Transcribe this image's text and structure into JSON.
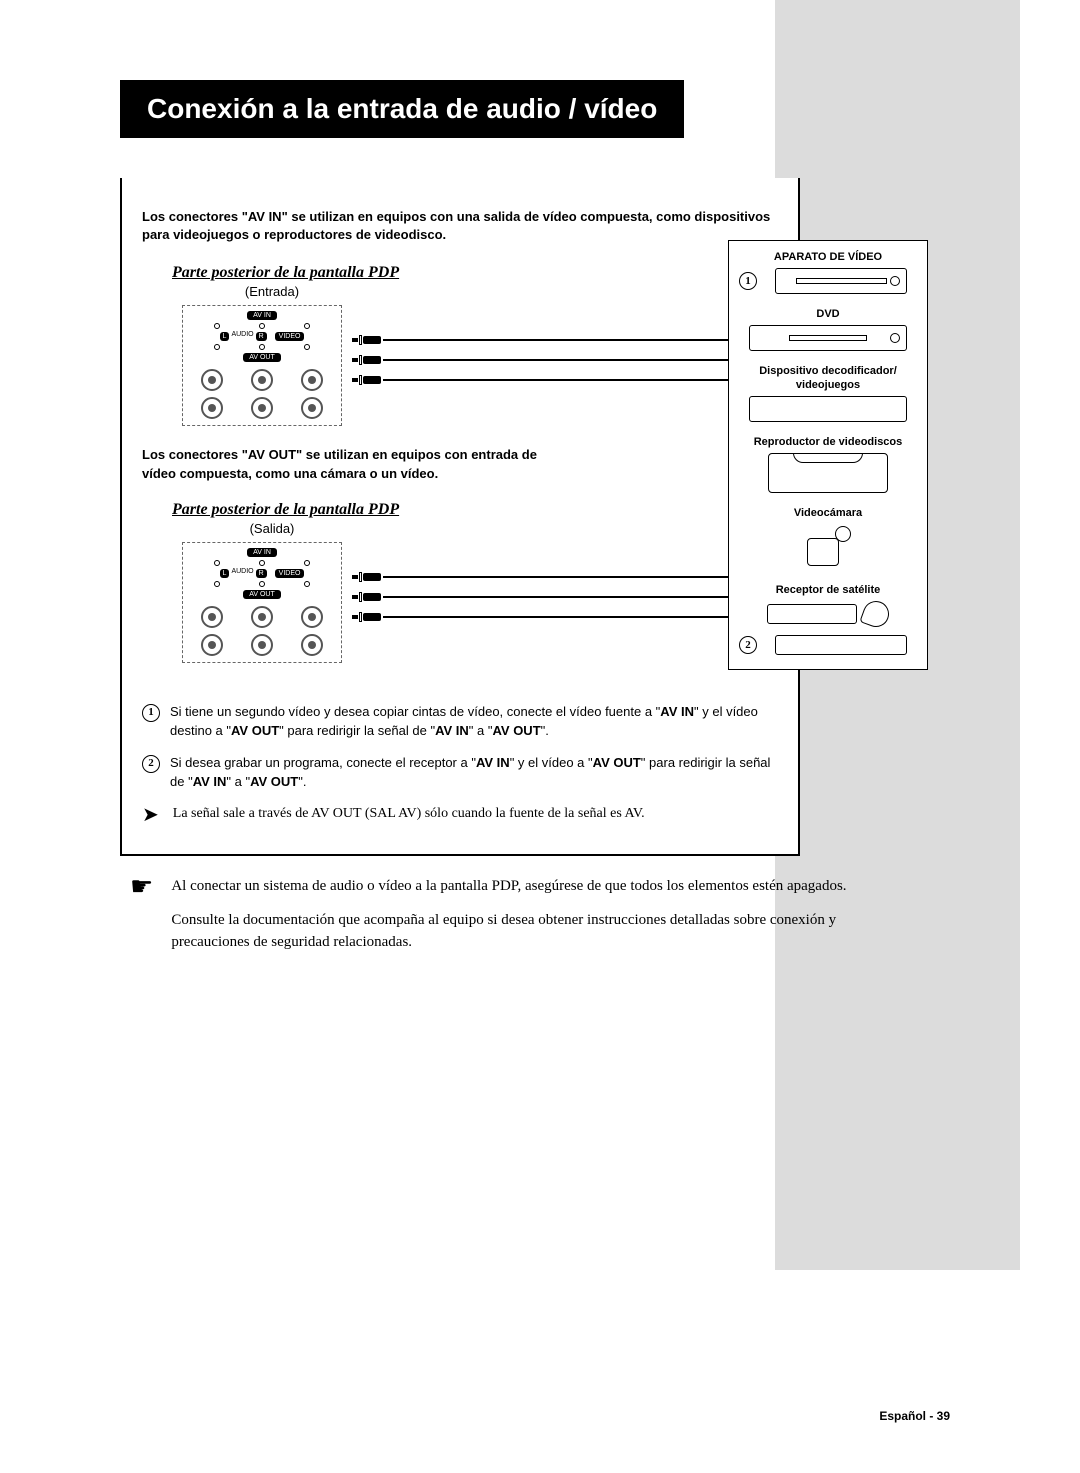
{
  "title": "Conexión a la entrada de audio / vídeo",
  "intro": "Los conectores \"AV IN\" se utilizan en equipos con una salida de vídeo compuesta, como dispositivos para videojuegos o reproductores de videodisco.",
  "section1": {
    "heading": "Parte posterior de la pantalla PDP",
    "sub": "(Entrada)"
  },
  "panel": {
    "avin": "AV IN",
    "avout": "AV OUT",
    "audio_l": "L",
    "audio": "AUDIO",
    "audio_r": "R",
    "video": "VIDEO"
  },
  "mid_text": "Los conectores \"AV OUT\" se utilizan en equipos con entrada de vídeo compuesta, como una cámara o un vídeo.",
  "section2": {
    "heading": "Parte posterior de la pantalla PDP",
    "sub": "(Salida)"
  },
  "devices": {
    "d1": "APARATO DE VÍDEO",
    "d2": "DVD",
    "d3": "Dispositivo decodificador/ videojuegos",
    "d4": "Reproductor de videodiscos",
    "d5": "Videocámara",
    "d6": "Receptor de satélite",
    "n1": "1",
    "n2": "2"
  },
  "notes": {
    "n1_num": "1",
    "n1_a": "Si tiene un segundo vídeo y desea copiar cintas de vídeo, conecte el vídeo fuente a \"",
    "n1_b": "AV IN",
    "n1_c": "\" y el vídeo destino a \"",
    "n1_d": "AV OUT",
    "n1_e": "\" para redirigir la señal de \"",
    "n1_f": "AV IN",
    "n1_g": "\" a \"",
    "n1_h": "AV OUT",
    "n1_i": "\".",
    "n2_num": "2",
    "n2_a": "Si desea grabar un programa, conecte el receptor a \"",
    "n2_b": "AV IN",
    "n2_c": "\" y el vídeo a \"",
    "n2_d": "AV OUT",
    "n2_e": "\" para redirigir la señal de \"",
    "n2_f": "AV IN",
    "n2_g": "\" a \"",
    "n2_h": "AV OUT",
    "n2_i": "\".",
    "arrow_text": "La señal sale a través de AV OUT (SAL AV) sólo cuando la fuente de la señal es AV."
  },
  "outer": {
    "p1": "Al conectar un sistema de audio o vídeo a la pantalla PDP, asegúrese de que todos los elementos estén apagados.",
    "p2": "Consulte la documentación que acompaña al equipo si desea obtener instrucciones detalladas sobre conexión y precauciones de seguridad relacionadas."
  },
  "footer": "Español - 39"
}
